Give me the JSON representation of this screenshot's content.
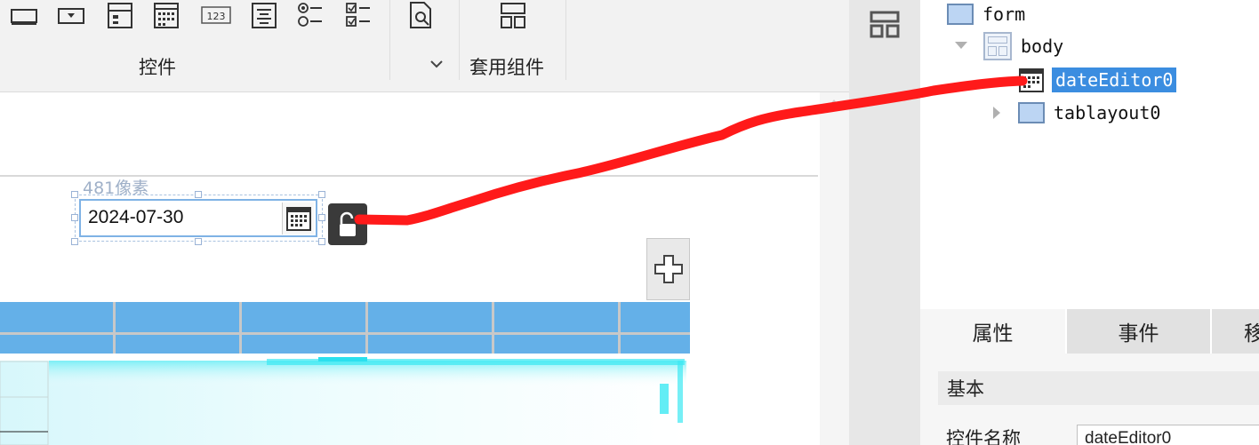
{
  "ribbon": {
    "group_controls_label": "控件",
    "group_templates_label": "套用组件",
    "toolbar_icons": [
      "text-box-icon",
      "dropdown-icon",
      "list-form-icon",
      "date-picker-icon",
      "number-field-icon",
      "text-area-icon",
      "radio-group-icon",
      "checkbox-group-icon",
      "search-doc-icon",
      "template-layout-icon"
    ]
  },
  "canvas": {
    "size_label": "481像素",
    "date_value": "2024-07-30"
  },
  "tree": {
    "root": "form",
    "body": "body",
    "selected": "dateEditor0",
    "tab_layout": "tablayout0"
  },
  "panel": {
    "tabs": [
      "属性",
      "事件",
      "移"
    ],
    "section_basic": "基本",
    "prop_name_label": "控件名称",
    "prop_name_value": "dateEditor0"
  },
  "colors": {
    "accent": "#3b8de0",
    "tab_header": "#64b0e8",
    "annotation": "#ff1a1a"
  }
}
